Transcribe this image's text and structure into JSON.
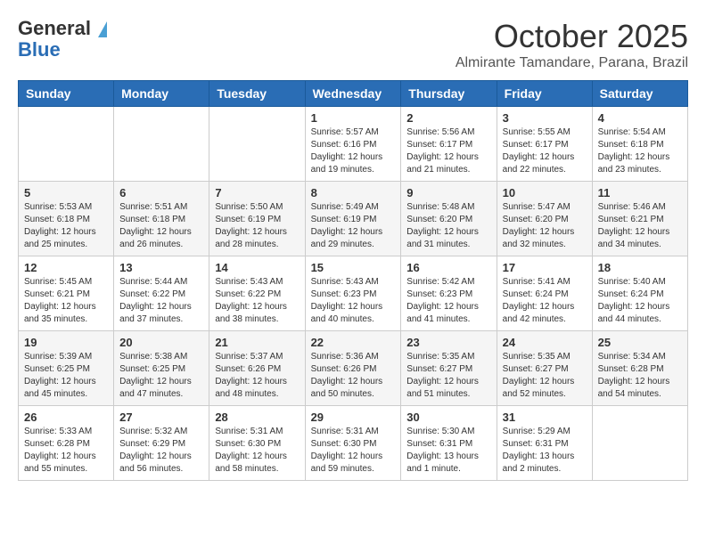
{
  "header": {
    "logo_line1": "General",
    "logo_line2": "Blue",
    "month": "October 2025",
    "location": "Almirante Tamandare, Parana, Brazil"
  },
  "days_of_week": [
    "Sunday",
    "Monday",
    "Tuesday",
    "Wednesday",
    "Thursday",
    "Friday",
    "Saturday"
  ],
  "weeks": [
    [
      {
        "day": "",
        "info": ""
      },
      {
        "day": "",
        "info": ""
      },
      {
        "day": "",
        "info": ""
      },
      {
        "day": "1",
        "info": "Sunrise: 5:57 AM\nSunset: 6:16 PM\nDaylight: 12 hours and 19 minutes."
      },
      {
        "day": "2",
        "info": "Sunrise: 5:56 AM\nSunset: 6:17 PM\nDaylight: 12 hours and 21 minutes."
      },
      {
        "day": "3",
        "info": "Sunrise: 5:55 AM\nSunset: 6:17 PM\nDaylight: 12 hours and 22 minutes."
      },
      {
        "day": "4",
        "info": "Sunrise: 5:54 AM\nSunset: 6:18 PM\nDaylight: 12 hours and 23 minutes."
      }
    ],
    [
      {
        "day": "5",
        "info": "Sunrise: 5:53 AM\nSunset: 6:18 PM\nDaylight: 12 hours and 25 minutes."
      },
      {
        "day": "6",
        "info": "Sunrise: 5:51 AM\nSunset: 6:18 PM\nDaylight: 12 hours and 26 minutes."
      },
      {
        "day": "7",
        "info": "Sunrise: 5:50 AM\nSunset: 6:19 PM\nDaylight: 12 hours and 28 minutes."
      },
      {
        "day": "8",
        "info": "Sunrise: 5:49 AM\nSunset: 6:19 PM\nDaylight: 12 hours and 29 minutes."
      },
      {
        "day": "9",
        "info": "Sunrise: 5:48 AM\nSunset: 6:20 PM\nDaylight: 12 hours and 31 minutes."
      },
      {
        "day": "10",
        "info": "Sunrise: 5:47 AM\nSunset: 6:20 PM\nDaylight: 12 hours and 32 minutes."
      },
      {
        "day": "11",
        "info": "Sunrise: 5:46 AM\nSunset: 6:21 PM\nDaylight: 12 hours and 34 minutes."
      }
    ],
    [
      {
        "day": "12",
        "info": "Sunrise: 5:45 AM\nSunset: 6:21 PM\nDaylight: 12 hours and 35 minutes."
      },
      {
        "day": "13",
        "info": "Sunrise: 5:44 AM\nSunset: 6:22 PM\nDaylight: 12 hours and 37 minutes."
      },
      {
        "day": "14",
        "info": "Sunrise: 5:43 AM\nSunset: 6:22 PM\nDaylight: 12 hours and 38 minutes."
      },
      {
        "day": "15",
        "info": "Sunrise: 5:43 AM\nSunset: 6:23 PM\nDaylight: 12 hours and 40 minutes."
      },
      {
        "day": "16",
        "info": "Sunrise: 5:42 AM\nSunset: 6:23 PM\nDaylight: 12 hours and 41 minutes."
      },
      {
        "day": "17",
        "info": "Sunrise: 5:41 AM\nSunset: 6:24 PM\nDaylight: 12 hours and 42 minutes."
      },
      {
        "day": "18",
        "info": "Sunrise: 5:40 AM\nSunset: 6:24 PM\nDaylight: 12 hours and 44 minutes."
      }
    ],
    [
      {
        "day": "19",
        "info": "Sunrise: 5:39 AM\nSunset: 6:25 PM\nDaylight: 12 hours and 45 minutes."
      },
      {
        "day": "20",
        "info": "Sunrise: 5:38 AM\nSunset: 6:25 PM\nDaylight: 12 hours and 47 minutes."
      },
      {
        "day": "21",
        "info": "Sunrise: 5:37 AM\nSunset: 6:26 PM\nDaylight: 12 hours and 48 minutes."
      },
      {
        "day": "22",
        "info": "Sunrise: 5:36 AM\nSunset: 6:26 PM\nDaylight: 12 hours and 50 minutes."
      },
      {
        "day": "23",
        "info": "Sunrise: 5:35 AM\nSunset: 6:27 PM\nDaylight: 12 hours and 51 minutes."
      },
      {
        "day": "24",
        "info": "Sunrise: 5:35 AM\nSunset: 6:27 PM\nDaylight: 12 hours and 52 minutes."
      },
      {
        "day": "25",
        "info": "Sunrise: 5:34 AM\nSunset: 6:28 PM\nDaylight: 12 hours and 54 minutes."
      }
    ],
    [
      {
        "day": "26",
        "info": "Sunrise: 5:33 AM\nSunset: 6:28 PM\nDaylight: 12 hours and 55 minutes."
      },
      {
        "day": "27",
        "info": "Sunrise: 5:32 AM\nSunset: 6:29 PM\nDaylight: 12 hours and 56 minutes."
      },
      {
        "day": "28",
        "info": "Sunrise: 5:31 AM\nSunset: 6:30 PM\nDaylight: 12 hours and 58 minutes."
      },
      {
        "day": "29",
        "info": "Sunrise: 5:31 AM\nSunset: 6:30 PM\nDaylight: 12 hours and 59 minutes."
      },
      {
        "day": "30",
        "info": "Sunrise: 5:30 AM\nSunset: 6:31 PM\nDaylight: 13 hours and 1 minute."
      },
      {
        "day": "31",
        "info": "Sunrise: 5:29 AM\nSunset: 6:31 PM\nDaylight: 13 hours and 2 minutes."
      },
      {
        "day": "",
        "info": ""
      }
    ]
  ]
}
